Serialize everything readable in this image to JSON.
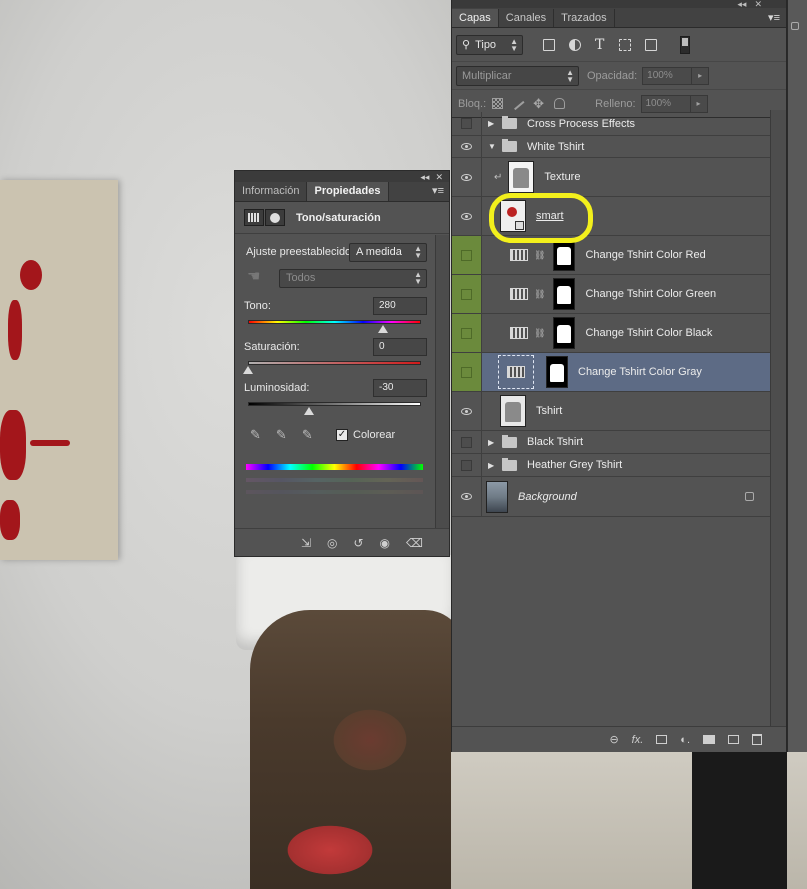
{
  "layers_panel": {
    "tabs": [
      "Capas",
      "Canales",
      "Trazados"
    ],
    "filter_type": "Tipo",
    "blend_mode": "Multiplicar",
    "opacity_label": "Opacidad:",
    "opacity_value": "100%",
    "lock_label": "Bloq.:",
    "fill_label": "Relleno:",
    "fill_value": "100%",
    "layers": [
      {
        "name": "Cross Process Effects",
        "kind": "group",
        "visible": false
      },
      {
        "name": "White Tshirt",
        "kind": "group-open",
        "visible": true
      },
      {
        "name": "Texture",
        "kind": "clipped",
        "visible": true
      },
      {
        "name": "smart",
        "kind": "smart-object",
        "visible": true
      },
      {
        "name": "Change Tshirt Color Red",
        "kind": "adjustment",
        "visible": false
      },
      {
        "name": "Change Tshirt Color Green",
        "kind": "adjustment",
        "visible": false
      },
      {
        "name": "Change Tshirt Color Black",
        "kind": "adjustment",
        "visible": false
      },
      {
        "name": "Change Tshirt Color Gray",
        "kind": "adjustment",
        "visible": false,
        "selected": true
      },
      {
        "name": "Tshirt",
        "kind": "pixel",
        "visible": true
      },
      {
        "name": "Black Tshirt",
        "kind": "group",
        "visible": false
      },
      {
        "name": "Heather Grey Tshirt",
        "kind": "group",
        "visible": false
      },
      {
        "name": "Background",
        "kind": "background",
        "visible": true,
        "locked": true
      }
    ]
  },
  "properties_panel": {
    "tabs": [
      "Información",
      "Propiedades"
    ],
    "title": "Tono/saturación",
    "preset_label": "Ajuste preestablecido:",
    "preset_value": "A medida",
    "channel_value": "Todos",
    "hue_label": "Tono:",
    "hue_value": "280",
    "saturation_label": "Saturación:",
    "saturation_value": "0",
    "lightness_label": "Luminosidad:",
    "lightness_value": "-30",
    "colorize_label": "Colorear",
    "colorize_checked": true,
    "hue_range": [
      -180,
      180
    ],
    "saturation_range": [
      -100,
      100
    ],
    "lightness_range": [
      -100,
      100
    ]
  },
  "colors": {
    "panel_bg": "#535353",
    "selected_row": "#5d6b85",
    "mask_column_green": "#6b8a3c",
    "highlight_ring": "#f3f01c"
  }
}
